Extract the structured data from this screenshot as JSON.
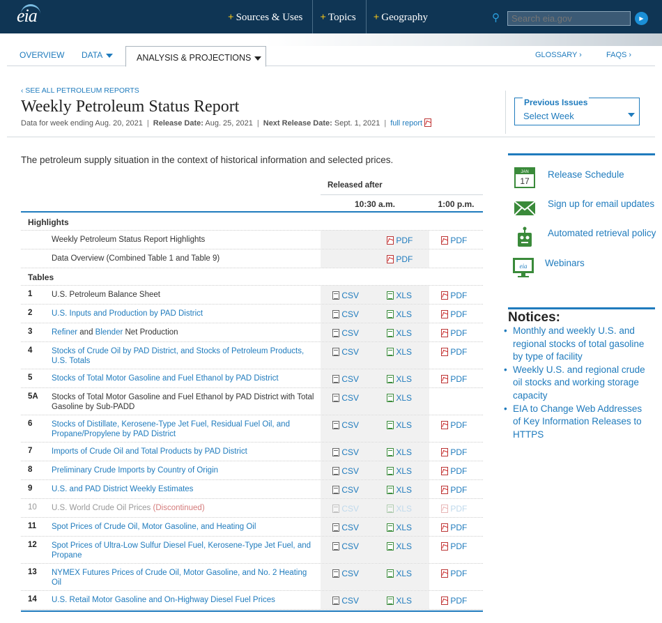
{
  "topbar": {
    "logo": "eia",
    "nav": [
      "Sources & Uses",
      "Topics",
      "Geography"
    ],
    "search_placeholder": "Search eia.gov"
  },
  "subnav": {
    "overview": "OVERVIEW",
    "data": "DATA",
    "analysis": "ANALYSIS & PROJECTIONS",
    "glossary": "GLOSSARY ›",
    "faqs": "FAQS ›"
  },
  "header": {
    "see_all": "‹ SEE ALL PETROLEUM REPORTS",
    "title": "Weekly Petroleum Status Report",
    "data_week": "Data for week ending Aug. 20, 2021",
    "release_label": "Release Date:",
    "release_date": "Aug. 25, 2021",
    "next_label": "Next Release Date:",
    "next_date": "Sept. 1, 2021",
    "full_report": "full report"
  },
  "previous_issues": {
    "label": "Previous Issues",
    "value": "Select Week"
  },
  "intro": "The petroleum supply situation in the context of historical information and selected prices.",
  "table": {
    "released_after": "Released after",
    "col_a": "10:30 a.m.",
    "col_b": "1:00 p.m.",
    "csv": "CSV",
    "xls": "XLS",
    "pdf": "PDF",
    "highlights_label": "Highlights",
    "tables_label": "Tables",
    "highlights": [
      {
        "desc": "Weekly Petroleum Status Report Highlights"
      },
      {
        "desc": "Data Overview (Combined Table 1 and Table 9)"
      }
    ],
    "rows": [
      {
        "num": "1",
        "desc": "U.S. Petroleum Balance Sheet"
      },
      {
        "num": "2",
        "desc": "U.S. Inputs and Production by PAD District"
      },
      {
        "num": "3",
        "desc_a": "Refiner",
        "desc_b": " and ",
        "desc_c": "Blender",
        "desc_d": " Net Production"
      },
      {
        "num": "4",
        "desc": "Stocks of Crude Oil by PAD District, and Stocks of Petroleum Products, U.S. Totals"
      },
      {
        "num": "5",
        "desc": "Stocks of Total Motor Gasoline and Fuel Ethanol by PAD District"
      },
      {
        "num": "5A",
        "desc": "Stocks of Total Motor Gasoline and Fuel Ethanol by PAD District with Total Gasoline by Sub-PADD"
      },
      {
        "num": "6",
        "desc": "Stocks of Distillate, Kerosene-Type Jet Fuel, Residual Fuel Oil, and Propane/Propylene by PAD District"
      },
      {
        "num": "7",
        "desc": "Imports of Crude Oil and Total Products by PAD District"
      },
      {
        "num": "8",
        "desc": "Preliminary Crude Imports by Country of Origin"
      },
      {
        "num": "9",
        "desc": "U.S. and PAD District Weekly Estimates"
      },
      {
        "num": "10",
        "desc": "U.S. World Crude Oil Prices ",
        "disc": "(Discontinued)"
      },
      {
        "num": "11",
        "desc": "Spot Prices of Crude Oil, Motor Gasoline, and Heating Oil"
      },
      {
        "num": "12",
        "desc": "Spot Prices of Ultra-Low Sulfur Diesel Fuel, Kerosene-Type Jet Fuel, and Propane"
      },
      {
        "num": "13",
        "desc": "NYMEX Futures Prices of Crude Oil, Motor Gasoline, and No. 2 Heating Oil"
      },
      {
        "num": "14",
        "desc": "U.S. Retail Motor Gasoline and On-Highway Diesel Fuel Prices"
      }
    ]
  },
  "sidebar": {
    "calendar_month": "JAN",
    "calendar_day": "17",
    "release_schedule": "Release Schedule",
    "email": "Sign up for email updates",
    "api": "Automated retrieval policy",
    "webinar_logo": "eia",
    "webinars": "Webinars",
    "notices_title": "Notices:",
    "notices": [
      "Monthly and weekly U.S. and regional stocks of total gasoline by type of facility",
      "Weekly U.S. and regional crude oil stocks and working storage capacity",
      "EIA to Change Web Addresses of Key Information Releases to HTTPS"
    ]
  }
}
